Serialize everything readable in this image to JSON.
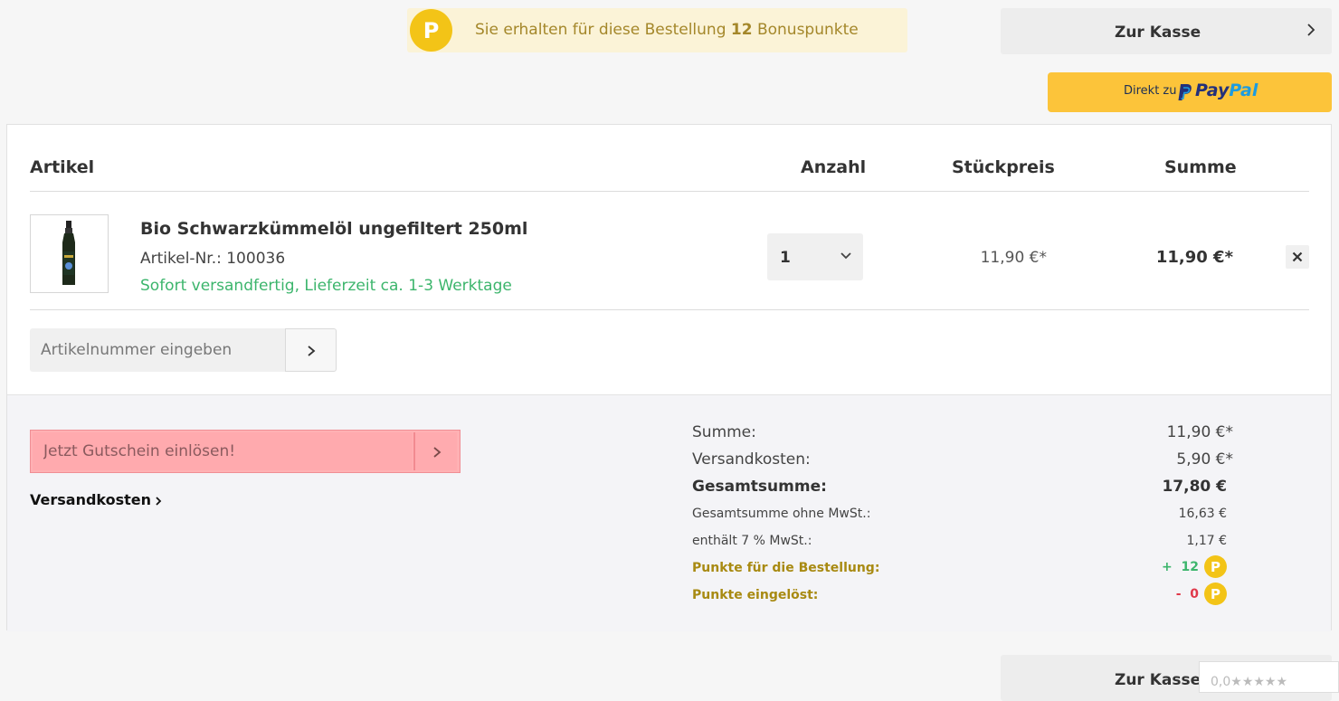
{
  "bonus_banner": {
    "badge": "P",
    "text_before": "Sie erhalten für diese Bestellung ",
    "points": "12",
    "text_after": " Bonuspunkte"
  },
  "checkout": {
    "label": "Zur Kasse"
  },
  "paypal": {
    "prefix": "Direkt zu",
    "brand_part1": "Pay",
    "brand_part2": "Pal"
  },
  "table": {
    "headers": {
      "article": "Artikel",
      "quantity": "Anzahl",
      "unit_price": "Stückpreis",
      "sum": "Summe"
    },
    "items": [
      {
        "name": "Bio Schwarzkümmelöl ungefiltert 250ml",
        "article_no": "Artikel-Nr.: 100036",
        "delivery": "Sofort versandfertig, Lieferzeit ca. 1-3 Werktage",
        "quantity": "1",
        "unit_price": "11,90 €*",
        "line_sum": "11,90 €*"
      }
    ]
  },
  "article_input": {
    "placeholder": "Artikelnummer eingeben"
  },
  "coupon": {
    "placeholder": "Jetzt Gutschein einlösen!"
  },
  "shipping_link": "Versandkosten",
  "summary": {
    "sum_label": "Summe:",
    "sum_value": "11,90 €*",
    "shipping_label": "Versandkosten:",
    "shipping_value": "5,90 €*",
    "total_label": "Gesamtsumme:",
    "total_value": "17,80 €",
    "net_label": "Gesamtsumme ohne MwSt.:",
    "net_value": "16,63 €",
    "vat_label": "enthält 7 % MwSt.:",
    "vat_value": "1,17 €",
    "points_order_label": "Punkte für die Bestellung:",
    "points_order_sign": "+",
    "points_order_value": "12",
    "points_redeemed_label": "Punkte eingelöst:",
    "points_redeemed_sign": "-",
    "points_redeemed_value": "0",
    "points_badge": "P"
  },
  "rating": {
    "text": "0,0★★★★★"
  },
  "colors": {
    "accent_yellow": "#f3c417",
    "paypal_yellow": "#fcc43a",
    "delivery_green": "#3cb56c",
    "coupon_highlight": "#ffb1b4"
  }
}
